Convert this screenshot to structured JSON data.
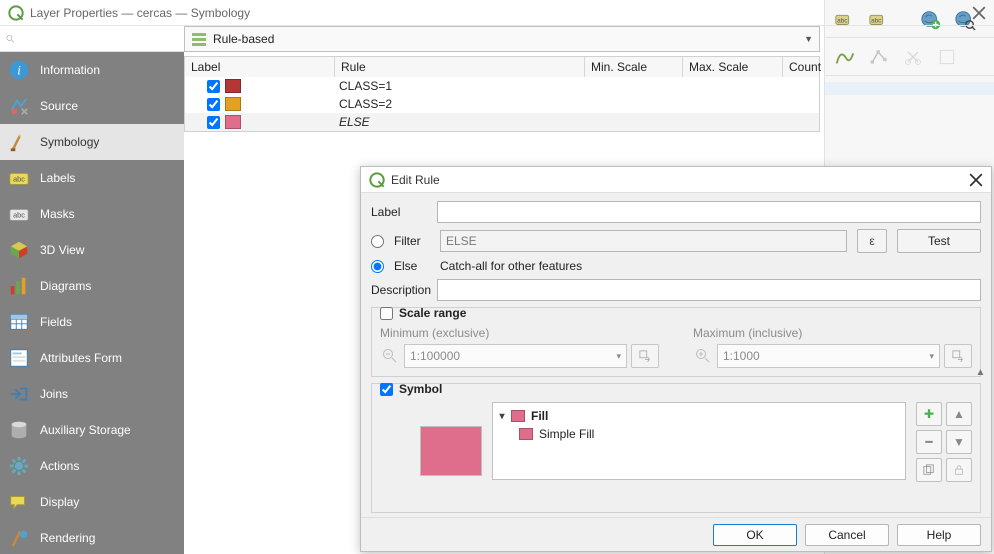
{
  "window": {
    "title": "Layer Properties — cercas — Symbology"
  },
  "sidebar": {
    "items": [
      {
        "label": "Information"
      },
      {
        "label": "Source"
      },
      {
        "label": "Symbology"
      },
      {
        "label": "Labels"
      },
      {
        "label": "Masks"
      },
      {
        "label": "3D View"
      },
      {
        "label": "Diagrams"
      },
      {
        "label": "Fields"
      },
      {
        "label": "Attributes Form"
      },
      {
        "label": "Joins"
      },
      {
        "label": "Auxiliary Storage"
      },
      {
        "label": "Actions"
      },
      {
        "label": "Display"
      },
      {
        "label": "Rendering"
      }
    ]
  },
  "renderer": {
    "mode": "Rule-based"
  },
  "rulesTable": {
    "headers": {
      "label": "Label",
      "rule": "Rule",
      "minScale": "Min. Scale",
      "maxScale": "Max. Scale",
      "count": "Count"
    },
    "rows": [
      {
        "checked": true,
        "color": "#b53636",
        "rule": "CLASS=1",
        "else": false
      },
      {
        "checked": true,
        "color": "#e3a023",
        "rule": "CLASS=2",
        "else": false
      },
      {
        "checked": true,
        "color": "#de6e8b",
        "rule": "ELSE",
        "else": true
      }
    ]
  },
  "editRule": {
    "title": "Edit Rule",
    "labelField": "",
    "filterLabel": "Filter",
    "filterValue": "ELSE",
    "testLabel": "Test",
    "elseLabel": "Else",
    "elseHint": "Catch-all for other features",
    "filterSelected": false,
    "descriptionLabel": "Description",
    "descriptionValue": "",
    "scale": {
      "header": "Scale range",
      "enabled": false,
      "minLabel": "Minimum (exclusive)",
      "minValue": "1:100000",
      "maxLabel": "Maximum (inclusive)",
      "maxValue": "1:1000"
    },
    "symbol": {
      "header": "Symbol",
      "enabled": true,
      "previewColor": "#de6e8b",
      "tree": [
        {
          "name": "Fill",
          "color": "#de6e8b",
          "level": 0,
          "expanded": true,
          "selected": true
        },
        {
          "name": "Simple Fill",
          "color": "#de6e8b",
          "level": 1,
          "selected": false
        }
      ]
    },
    "buttons": {
      "ok": "OK",
      "cancel": "Cancel",
      "help": "Help"
    },
    "labelRowLabel": "Label"
  },
  "icons": {
    "epsilon": "ε"
  }
}
